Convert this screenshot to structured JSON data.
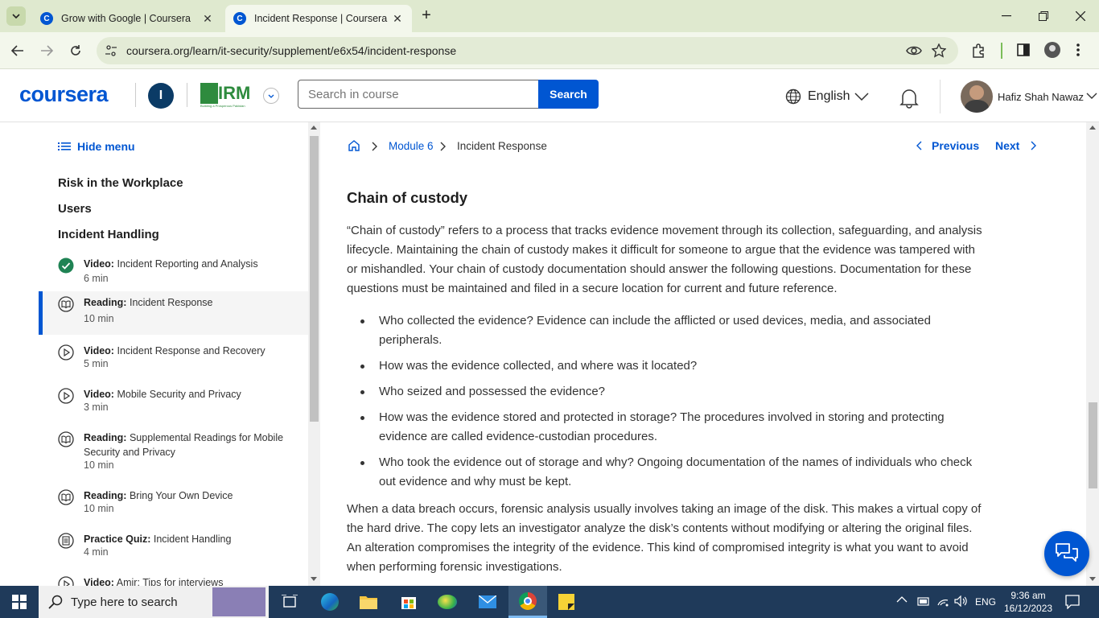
{
  "browser": {
    "tabs": [
      {
        "title": "Grow with Google | Coursera",
        "active": false
      },
      {
        "title": "Incident Response | Coursera",
        "active": true
      }
    ],
    "url": "coursera.org/learn/it-security/supplement/e6x54/incident-response"
  },
  "header": {
    "logo": "coursera",
    "org_badge_letter": "I",
    "partner_logo_text": "IRM",
    "partner_tagline": "Building a Prosperous Pakistan",
    "search_placeholder": "Search in course",
    "search_button": "Search",
    "language": "English",
    "user_name": "Hafiz Shah Nawaz"
  },
  "sidebar": {
    "hide_menu": "Hide menu",
    "sections": [
      "Risk in the Workplace",
      "Users",
      "Incident Handling"
    ],
    "items": [
      {
        "type": "Video:",
        "title": "Incident Reporting and Analysis",
        "duration": "6 min",
        "icon": "check-circle-icon"
      },
      {
        "type": "Reading:",
        "title": "Incident Response",
        "duration": "10 min",
        "icon": "book-icon"
      },
      {
        "type": "Video:",
        "title": "Incident Response and Recovery",
        "duration": "5 min",
        "icon": "play-circle-icon"
      },
      {
        "type": "Video:",
        "title": "Mobile Security and Privacy",
        "duration": "3 min",
        "icon": "play-circle-icon"
      },
      {
        "type": "Reading:",
        "title": "Supplemental Readings for Mobile Security and Privacy",
        "duration": "10 min",
        "icon": "book-icon"
      },
      {
        "type": "Reading:",
        "title": "Bring Your Own Device",
        "duration": "10 min",
        "icon": "book-icon"
      },
      {
        "type": "Practice Quiz:",
        "title": "Incident Handling",
        "duration": "4 min",
        "icon": "quiz-icon"
      },
      {
        "type": "Video:",
        "title": "Amir: Tips for interviews",
        "duration": "",
        "icon": "play-circle-icon"
      }
    ]
  },
  "breadcrumb": {
    "module": "Module 6",
    "current": "Incident Response"
  },
  "pager": {
    "previous": "Previous",
    "next": "Next"
  },
  "content": {
    "heading": "Chain of custody",
    "intro": "“Chain of custody” refers to a process that tracks evidence movement through its collection, safeguarding, and analysis lifecycle. Maintaining the chain of custody makes it difficult for someone to argue that the evidence was tampered with or mishandled. Your chain of custody documentation should answer the following questions. Documentation for these questions must be maintained and filed in a secure location for current and future reference.",
    "bullets": [
      "Who collected the evidence? Evidence can include the afflicted or used devices, media, and associated peripherals.",
      "How was the evidence collected, and where was it located?",
      "Who seized and possessed the evidence?",
      "How was the evidence stored and protected in storage? The procedures involved in storing and protecting evidence are called evidence-custodian procedures.",
      "Who took the evidence out of storage and why? Ongoing documentation of the names of individuals who check out evidence and why must be kept."
    ],
    "outro": "When a data breach occurs, forensic analysis usually involves taking an image of the disk. This makes a virtual copy of the hard drive. The copy lets an investigator analyze the disk’s contents without modifying or altering the original files. An alteration compromises the integrity of the evidence. This kind of compromised integrity is what you want to avoid when performing forensic investigations."
  },
  "taskbar": {
    "search_placeholder": "Type here to search",
    "lang": "ENG",
    "time": "9:36 am",
    "date": "16/12/2023"
  },
  "colors": {
    "brand": "#0056d2",
    "tabstrip": "#dfe9cf",
    "taskbar": "#1f3a5a",
    "complete": "#1f8354"
  }
}
